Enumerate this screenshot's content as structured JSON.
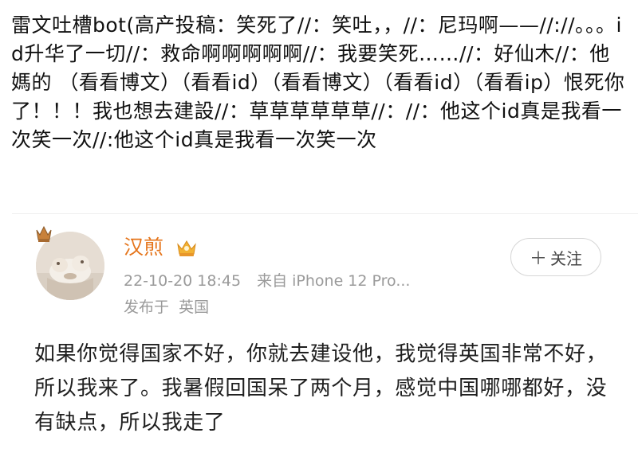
{
  "caption": {
    "text": "雷文吐槽bot(高产投稿：笑死了//：笑吐，，//：尼玛啊——//://。。。id升华了一切//：救命啊啊啊啊啊//：我要笑死……//：好仙木//：他媽的 （看看博文）（看看id）（看看博文）（看看id）（看看ip）恨死你了！！！我也想去建設//：草草草草草草//：//：他这个id真是我看一次笑一次//:他这个id真是我看一次笑一次"
  },
  "post": {
    "username": "汉煎",
    "timestamp": "22-10-20 18:45",
    "source": "来自 iPhone 12 Pro...",
    "location_prefix": "发布于",
    "location": "英国",
    "follow_label": "关注",
    "body": "如果你觉得国家不好，你就去建设他，我觉得英国非常不好，所以我来了。我暑假回国呆了两个月，感觉中国哪哪都好，没有缺点，所以我走了"
  },
  "icons": {
    "crown": "crown-icon",
    "vip": "vip-badge-icon",
    "plus": "plus-icon"
  },
  "colors": {
    "username": "#e5741a",
    "meta": "#9a9a9a",
    "text": "#111111"
  }
}
